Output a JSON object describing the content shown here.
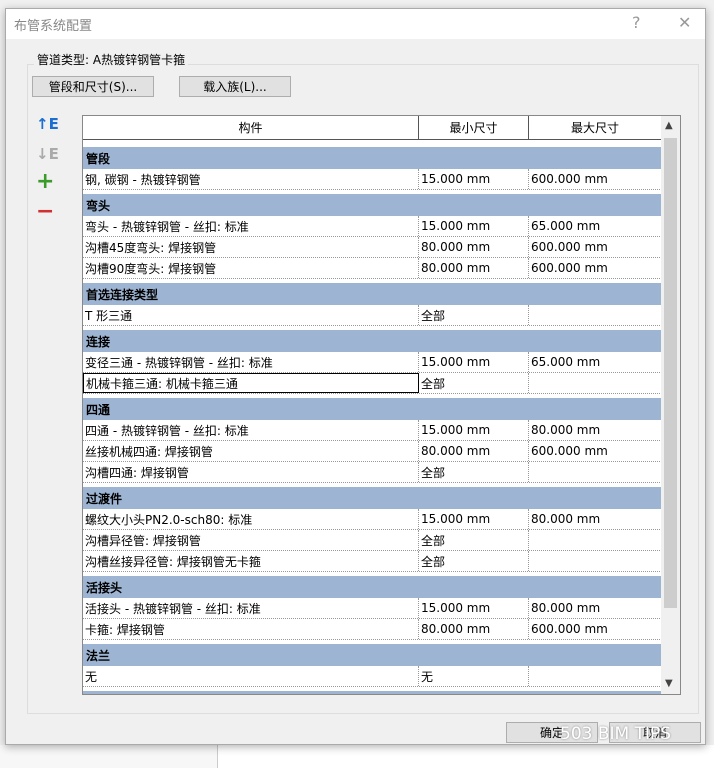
{
  "dialog": {
    "title": "布管系统配置",
    "help": "?",
    "close": "✕"
  },
  "pipe_type": "管道类型: A热镀锌钢管卡箍",
  "buttons": {
    "segments": "管段和尺寸(S)...",
    "load_family": "载入族(L)...",
    "ok": "确定",
    "cancel": "取消"
  },
  "side_icons": {
    "move_up": "↑E",
    "move_down": "↓E",
    "add": "+",
    "remove": "−"
  },
  "table": {
    "headers": [
      "构件",
      "最小尺寸",
      "最大尺寸"
    ],
    "groups": [
      {
        "name": "管段",
        "rows": [
          [
            "钢, 碳钢 - 热镀锌钢管",
            "15.000 mm",
            "600.000 mm"
          ]
        ]
      },
      {
        "name": "弯头",
        "rows": [
          [
            "弯头 - 热镀锌钢管 - 丝扣: 标准",
            "15.000 mm",
            "65.000 mm"
          ],
          [
            "沟槽45度弯头: 焊接钢管",
            "80.000 mm",
            "600.000 mm"
          ],
          [
            "沟槽90度弯头: 焊接钢管",
            "80.000 mm",
            "600.000 mm"
          ]
        ]
      },
      {
        "name": "首选连接类型",
        "rows": [
          [
            "T 形三通",
            "全部",
            ""
          ]
        ]
      },
      {
        "name": "连接",
        "rows": [
          [
            "变径三通 - 热镀锌钢管 - 丝扣: 标准",
            "15.000 mm",
            "65.000 mm"
          ],
          [
            "机械卡箍三通: 机械卡箍三通",
            "全部",
            ""
          ]
        ]
      },
      {
        "name": "四通",
        "rows": [
          [
            "四通 - 热镀锌钢管 - 丝扣: 标准",
            "15.000 mm",
            "80.000 mm"
          ],
          [
            "丝接机械四通: 焊接钢管",
            "80.000 mm",
            "600.000 mm"
          ],
          [
            "沟槽四通: 焊接钢管",
            "全部",
            ""
          ]
        ]
      },
      {
        "name": "过渡件",
        "rows": [
          [
            "螺纹大小头PN2.0-sch80: 标准",
            "15.000 mm",
            "80.000 mm"
          ],
          [
            "沟槽异径管: 焊接钢管",
            "全部",
            ""
          ],
          [
            "沟槽丝接异径管: 焊接钢管无卡箍",
            "全部",
            ""
          ]
        ]
      },
      {
        "name": "活接头",
        "rows": [
          [
            "活接头 - 热镀锌钢管 - 丝扣: 标准",
            "15.000 mm",
            "80.000 mm"
          ],
          [
            "卡箍: 焊接钢管",
            "80.000 mm",
            "600.000 mm"
          ]
        ]
      },
      {
        "name": "法兰",
        "rows": [
          [
            "无",
            "无",
            ""
          ]
        ]
      },
      {
        "name": "",
        "rows": []
      }
    ]
  },
  "watermark": "503 BIM TIPS",
  "colors": {
    "group_header": "#9db4d2",
    "up_icon": "#1a6fd1",
    "add_icon": "#3a9a2a",
    "remove_icon": "#d03030"
  }
}
